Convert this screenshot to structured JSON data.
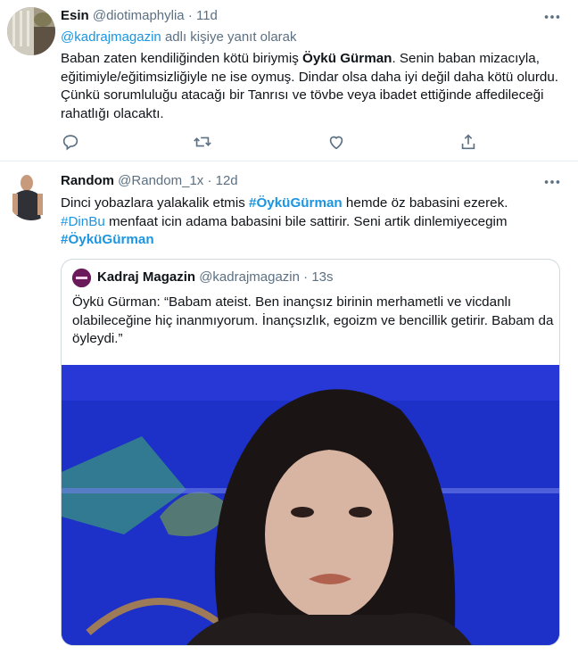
{
  "tweet1": {
    "name": "Esin",
    "handle": "@diotimaphylia",
    "sep": "·",
    "time": "11d",
    "reply_to_handle": "@kadrajmagazin",
    "reply_suffix": " adlı kişiye yanıt olarak",
    "text_pre": "Baban zaten kendiliğinden kötü biriymiş ",
    "text_bold": "Öykü Gürman",
    "text_post": ". Senin baban mizacıyla, eğitimiyle/eğitimsizliğiyle ne ise oymuş. Dindar olsa daha iyi değil daha kötü olurdu. Çünkü sorumluluğu atacağı bir Tanrısı ve tövbe veya ibadet ettiğinde affedileceği rahatlığı olacaktı."
  },
  "tweet2": {
    "name": "Random",
    "handle": "@Random_1x",
    "sep": "·",
    "time": "12d",
    "text_a": "Dinci yobazlara yalakalik etmis ",
    "hashtag1": "#ÖyküGürman",
    "text_b": " hemde öz babasini ezerek.",
    "hashtag2": "#DinBu",
    "text_c": " menfaat icin adama babasini bile sattirir. Seni artik dinlemiyecegim",
    "hashtag3": "#ÖyküGürman",
    "quote": {
      "name": "Kadraj Magazin",
      "handle": "@kadrajmagazin",
      "sep": "·",
      "time": "13s",
      "text": "Öykü Gürman: “Babam ateist. Ben inançsız birinin merhametli ve vicdanlı olabileceğine hiç inanmıyorum. İnançsızlık, egoizm ve bencillik getirir. Babam da öyleydi.”"
    }
  },
  "icons": [
    "more-icon",
    "reply-icon",
    "retweet-icon",
    "like-icon",
    "share-icon"
  ],
  "colors": {
    "link": "#1b95e0",
    "muted": "#5b7083",
    "border": "#e6ecf0",
    "image_bg": "#1d30c8"
  }
}
